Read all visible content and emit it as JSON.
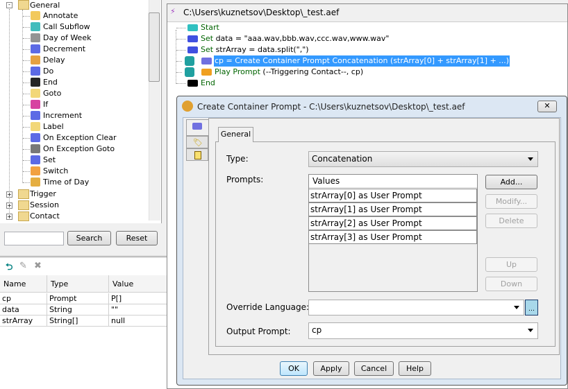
{
  "palette": {
    "root": {
      "label": "General"
    },
    "items": [
      {
        "label": "Annotate",
        "icon": "annotate-icon",
        "color": "#f0c040"
      },
      {
        "label": "Call Subflow",
        "icon": "call-subflow-icon",
        "color": "#20b0b0"
      },
      {
        "label": "Day of Week",
        "icon": "calendar-icon",
        "color": "#808080"
      },
      {
        "label": "Decrement",
        "icon": "minus-icon",
        "color": "#4050e0"
      },
      {
        "label": "Delay",
        "icon": "hourglass-icon",
        "color": "#e09020"
      },
      {
        "label": "Do",
        "icon": "do-icon",
        "color": "#4050e0"
      },
      {
        "label": "End",
        "icon": "checkered-flag-icon",
        "color": "#000000"
      },
      {
        "label": "Goto",
        "icon": "goto-tag-icon",
        "color": "#f0d060"
      },
      {
        "label": "If",
        "icon": "if-branch-icon",
        "color": "#d02090"
      },
      {
        "label": "Increment",
        "icon": "plus-icon",
        "color": "#4050e0"
      },
      {
        "label": "Label",
        "icon": "label-tag-icon",
        "color": "#f0d060"
      },
      {
        "label": "On Exception Clear",
        "icon": "exception-clear-icon",
        "color": "#4050e0"
      },
      {
        "label": "On Exception Goto",
        "icon": "exception-goto-icon",
        "color": "#606060"
      },
      {
        "label": "Set",
        "icon": "set-equals-icon",
        "color": "#4050e0"
      },
      {
        "label": "Switch",
        "icon": "switch-icon",
        "color": "#f09020"
      },
      {
        "label": "Time of Day",
        "icon": "clock-icon",
        "color": "#e0a020"
      }
    ],
    "folders": [
      {
        "label": "Trigger"
      },
      {
        "label": "Session"
      },
      {
        "label": "Contact"
      }
    ]
  },
  "search": {
    "value": "",
    "search_label": "Search",
    "reset_label": "Reset"
  },
  "variables": {
    "columns": [
      "Name",
      "Type",
      "Value"
    ],
    "rows": [
      [
        "cp",
        "Prompt",
        "P[]"
      ],
      [
        "data",
        "String",
        "\"\""
      ],
      [
        "strArray",
        "String[]",
        "null"
      ]
    ]
  },
  "flow": {
    "title": "C:\\Users\\kuznetsov\\Desktop\\_test.aef",
    "steps": [
      {
        "kw": "Start",
        "rest": ""
      },
      {
        "kw": "Set",
        "rest": " data = \"aaa.wav,bbb.wav,ccc.wav,www.wav\""
      },
      {
        "kw": "Set",
        "rest": " strArray = data.split(\",\")"
      },
      {
        "kw": "",
        "rest": "cp = Create Container Prompt Concatenation (strArray[0] + strArray[1] + ...)"
      },
      {
        "kw": "Play Prompt",
        "rest": " (--Triggering Contact--, cp)"
      },
      {
        "kw": "End",
        "rest": ""
      }
    ]
  },
  "dialog": {
    "title": "Create Container Prompt - C:\\Users\\kuznetsov\\Desktop\\_test.aef",
    "tab": "General",
    "type_label": "Type:",
    "type_value": "Concatenation",
    "prompts_label": "Prompts:",
    "list_header": "Values",
    "prompts": [
      "strArray[0] as User Prompt",
      "strArray[1] as User Prompt",
      "strArray[2] as User Prompt",
      "strArray[3] as User Prompt"
    ],
    "add": "Add...",
    "modify": "Modify...",
    "delete": "Delete",
    "up": "Up",
    "down": "Down",
    "override_label": "Override Language:",
    "override_value": "",
    "output_label": "Output Prompt:",
    "output_value": "cp",
    "ok": "OK",
    "apply": "Apply",
    "cancel": "Cancel",
    "help": "Help"
  },
  "colors": {
    "selection": "#3399ff",
    "keyword": "#006400"
  }
}
